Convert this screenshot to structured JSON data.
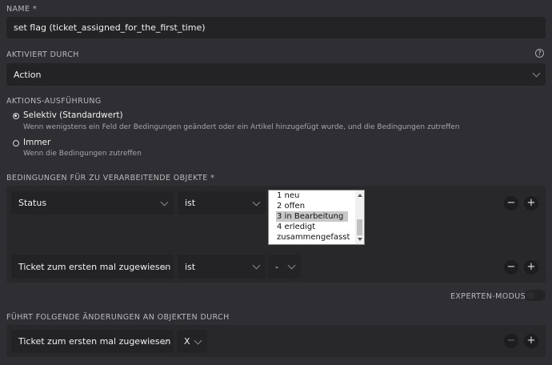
{
  "name": {
    "label": "NAME *",
    "value": "set flag (ticket_assigned_for_the_first_time)"
  },
  "activated_by": {
    "label": "AKTIVIERT DURCH",
    "help_icon": "?",
    "value": "Action"
  },
  "execution": {
    "label": "AKTIONS-AUSFÜHRUNG",
    "options": [
      {
        "title": "Selektiv (Standardwert)",
        "desc": "Wenn wenigstens ein Feld der Bedingungen geändert oder ein Artikel hinzugefügt wurde, und die Bedingungen zutreffen",
        "selected": true
      },
      {
        "title": "Immer",
        "desc": "Wenn die Bedingungen zutreffen",
        "selected": false
      }
    ]
  },
  "conditions": {
    "label": "BEDINGUNGEN FÜR ZU VERARBEITENDE OBJEKTE *",
    "rows": [
      {
        "attribute": "Status",
        "operator": "ist",
        "values": [
          "1 neu",
          "2 offen",
          "3 in Bearbeitung",
          "4 erledigt",
          "zusammengefasst"
        ],
        "selected_value": "3 in Bearbeitung"
      },
      {
        "attribute": "Ticket zum ersten mal zugewiesen",
        "operator": "ist",
        "value": "-"
      }
    ],
    "remove_icon": "−",
    "add_icon": "+"
  },
  "expert_mode": {
    "label": "EXPERTEN-MODUS",
    "enabled": false
  },
  "changes": {
    "label": "FÜHRT FOLGENDE ÄNDERUNGEN AN OBJEKTEN DURCH",
    "rows": [
      {
        "attribute": "Ticket zum ersten mal zugewiesen",
        "value": "X"
      }
    ],
    "remove_icon": "−",
    "add_icon": "+"
  }
}
